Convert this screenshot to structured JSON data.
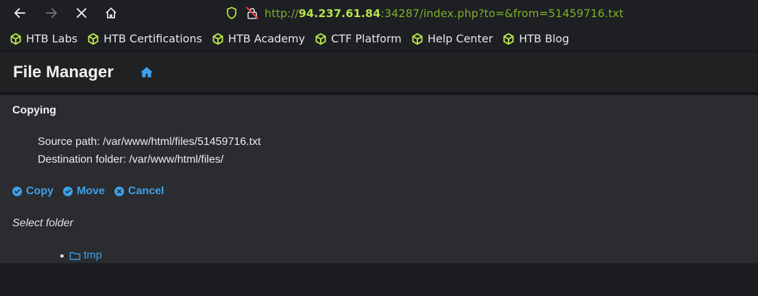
{
  "browser": {
    "url_prefix": "http://",
    "url_host": "94.237.61.84",
    "url_rest": ":34287/index.php?to=&from=51459716.txt"
  },
  "bookmarks": [
    {
      "label": "HTB Labs"
    },
    {
      "label": "HTB Certifications"
    },
    {
      "label": "HTB Academy"
    },
    {
      "label": "CTF Platform"
    },
    {
      "label": "Help Center"
    },
    {
      "label": "HTB Blog"
    }
  ],
  "app": {
    "title": "File Manager"
  },
  "copy_panel": {
    "heading": "Copying",
    "source_path": "Source path: /var/www/html/files/51459716.txt",
    "destination_folder": "Destination folder: /var/www/html/files/",
    "actions": {
      "copy": "Copy",
      "move": "Move",
      "cancel": "Cancel"
    },
    "select_label": "Select folder",
    "folders": [
      {
        "name": "tmp"
      }
    ]
  },
  "colors": {
    "accent": "#3ea1ea",
    "bookmark_icon": "#b6e34a",
    "url_text": "#7fb02a"
  }
}
